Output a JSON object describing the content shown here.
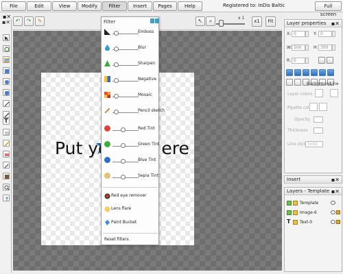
{
  "menubar": {
    "items": [
      "File",
      "Edit",
      "View",
      "Modify",
      "Filter",
      "Insert",
      "Pages",
      "Help"
    ],
    "registered": "Registered to: InDis Baltic",
    "fullscreen": "Full screen"
  },
  "toolbar": {
    "zoom_value": "x 1",
    "btn_x1": "x1",
    "btn_fit": "Fit"
  },
  "canvas": {
    "text_left": "Put yo",
    "text_right": "ere"
  },
  "filter_menu": {
    "title": "Filter",
    "items": [
      {
        "label": "Emboss",
        "icon": "emboss-icon",
        "slider": 0.1
      },
      {
        "label": "Blur",
        "icon": "blur-icon",
        "slider": 0.1
      },
      {
        "label": "Sharpen",
        "icon": "sharpen-icon",
        "slider": 0.1
      },
      {
        "label": "Negative",
        "icon": "negative-icon",
        "slider": 0.1
      },
      {
        "label": "Mosaic",
        "icon": "mosaic-icon",
        "slider": 0.1
      },
      {
        "label": "Pencil sketch",
        "icon": "pencil-icon",
        "slider": 0.1
      },
      {
        "label": "Red Tint",
        "icon": "red-tint-icon",
        "slider": 0.6
      },
      {
        "label": "Green Tint",
        "icon": "green-tint-icon",
        "slider": 0.6
      },
      {
        "label": "Blue Tint",
        "icon": "blue-tint-icon",
        "slider": 0.6
      },
      {
        "label": "Sepia Tint",
        "icon": "sepia-tint-icon",
        "slider": 0.6
      }
    ],
    "plain_items": [
      {
        "label": "Red eye remover",
        "icon": "red-eye-icon"
      },
      {
        "label": "Lens flare",
        "icon": "lens-flare-icon"
      },
      {
        "label": "Paint Bucket",
        "icon": "paint-bucket-icon"
      }
    ],
    "reset": "Reset filters"
  },
  "layer_properties": {
    "title": "Layer properties",
    "x_label": "X:",
    "x_value": "0",
    "y_label": "Y:",
    "y_value": "0",
    "w_label": "W:",
    "w_value": "500",
    "h_label": "H:",
    "h_value": "300",
    "r_label": "R:",
    "r_value": "0",
    "background": "Background",
    "line": "Line",
    "layer_colors": "Layer colors",
    "pipette_colors": "Pipette colors",
    "opacity": "Opacity",
    "thickness": "Thickness",
    "line_style": "Line style",
    "line_style_value": "Solid"
  },
  "insert_panel": {
    "title": "Insert"
  },
  "layers_panel": {
    "title": "Layers - Template",
    "layers": [
      {
        "name": "Template",
        "type": "image"
      },
      {
        "name": "Image-6",
        "type": "image"
      },
      {
        "name": "Text-0",
        "type": "text"
      }
    ]
  },
  "colors": {
    "accent_blue": "#39a0c8",
    "align_blue": "#2f6ec0",
    "canvas_dark": "#6e6e6e"
  }
}
